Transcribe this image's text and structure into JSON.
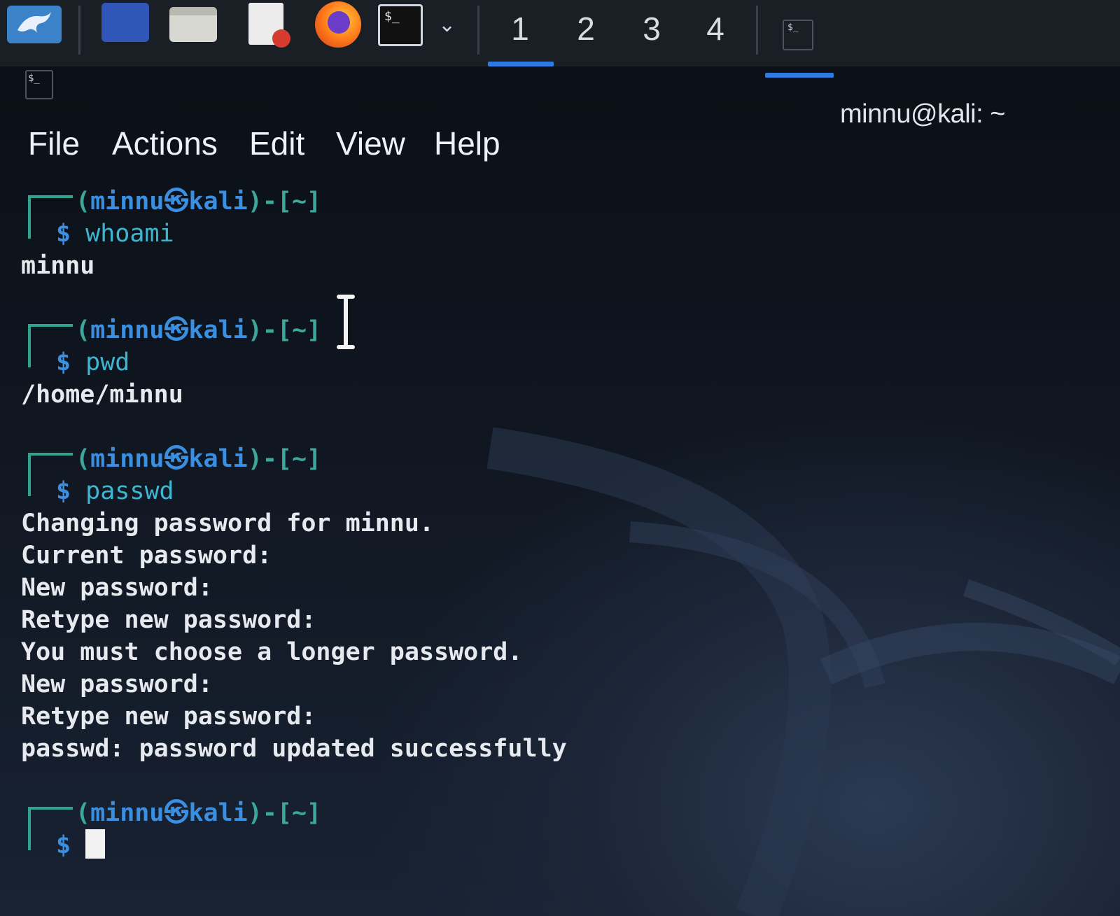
{
  "taskbar": {
    "workspaces": [
      "1",
      "2",
      "3",
      "4"
    ],
    "active_workspace": "1",
    "icons": [
      "kali-dragon-icon",
      "show-desktop-icon",
      "file-manager-icon",
      "text-editor-icon",
      "firefox-icon",
      "terminal-icon",
      "chevron-down-icon",
      "terminal-window-icon"
    ]
  },
  "window": {
    "title": "minnu@kali: ~"
  },
  "menu": {
    "file": "File",
    "actions": "Actions",
    "edit": "Edit",
    "view": "View",
    "help": "Help"
  },
  "prompt": {
    "user": "minnu",
    "at": "㉿",
    "host": "kali",
    "dir": "~",
    "symbol": "$"
  },
  "sessions": [
    {
      "command": "whoami",
      "output": [
        "minnu"
      ]
    },
    {
      "command": "pwd",
      "output": [
        "/home/minnu"
      ]
    },
    {
      "command": "passwd",
      "output": [
        "Changing password for minnu.",
        "Current password:",
        "New password:",
        "Retype new password:",
        "You must choose a longer password.",
        "New password:",
        "Retype new password:",
        "passwd: password updated successfully"
      ]
    }
  ],
  "colors": {
    "accent_blue": "#3b8fe0",
    "prompt_teal": "#2ea38f",
    "workspace_underline": "#2f7ae0"
  }
}
